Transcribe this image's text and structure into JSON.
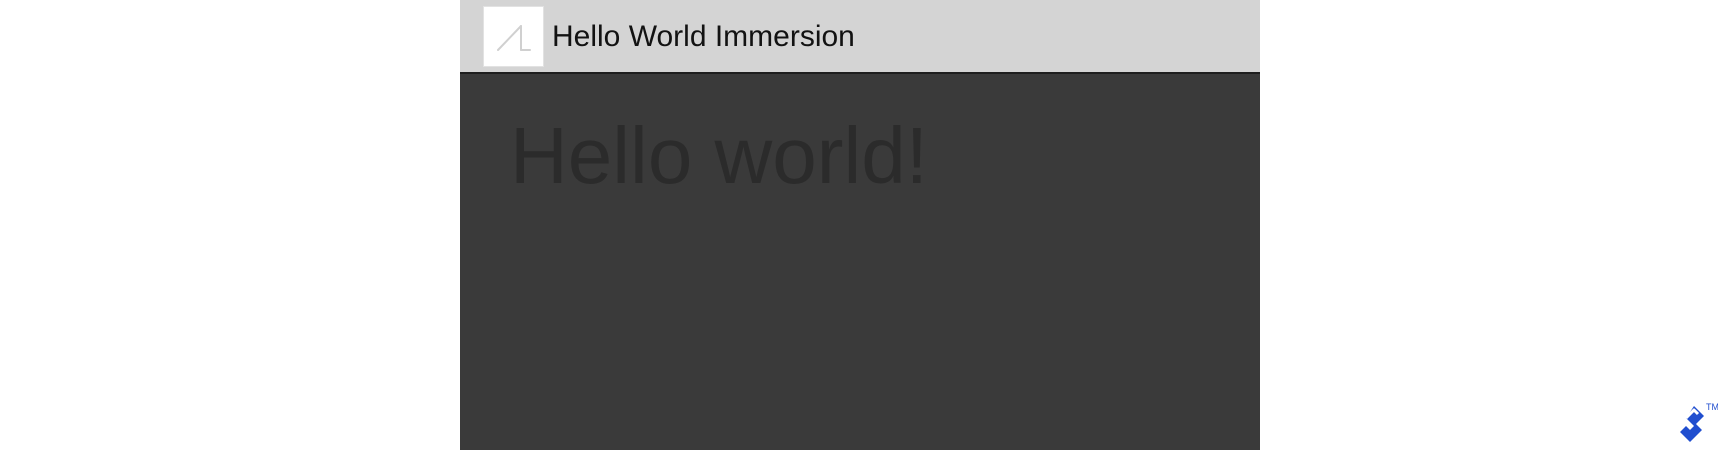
{
  "app": {
    "title": "Hello World Immersion",
    "icon": "glass-app-icon"
  },
  "content": {
    "text": "Hello world!"
  },
  "brand": {
    "icon": "toptal-logo-icon",
    "trademark": "TM"
  },
  "colors": {
    "action_bar": "#d4d4d4",
    "content_background": "#3a3a3a",
    "hello_text": "#2b2b2b",
    "brand_blue": "#204ecf"
  }
}
